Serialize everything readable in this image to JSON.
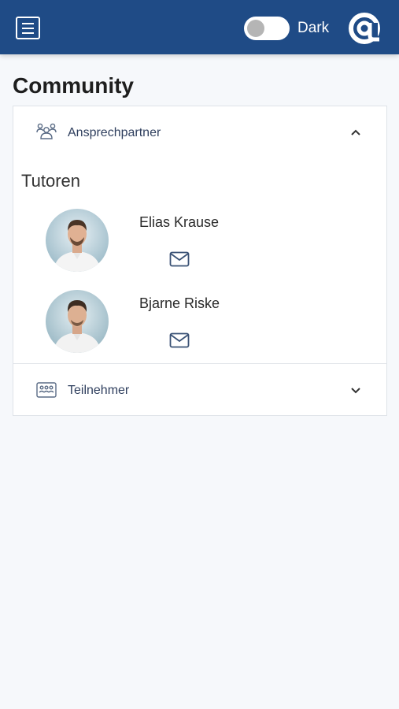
{
  "header": {
    "theme_toggle_label": "Dark",
    "accent": "#1f4b86"
  },
  "page": {
    "title": "Community"
  },
  "sections": {
    "contacts": {
      "label": "Ansprechpartner",
      "expanded": true,
      "group_title": "Tutoren",
      "people": [
        {
          "name": "Elias Krause"
        },
        {
          "name": "Bjarne Riske"
        }
      ]
    },
    "participants": {
      "label": "Teilnehmer",
      "expanded": false
    }
  },
  "icons": {
    "menu": "menu-icon",
    "logo": "at-sign-logo",
    "contacts": "people-group-icon",
    "participants": "id-card-icon",
    "mail": "mail-icon"
  }
}
